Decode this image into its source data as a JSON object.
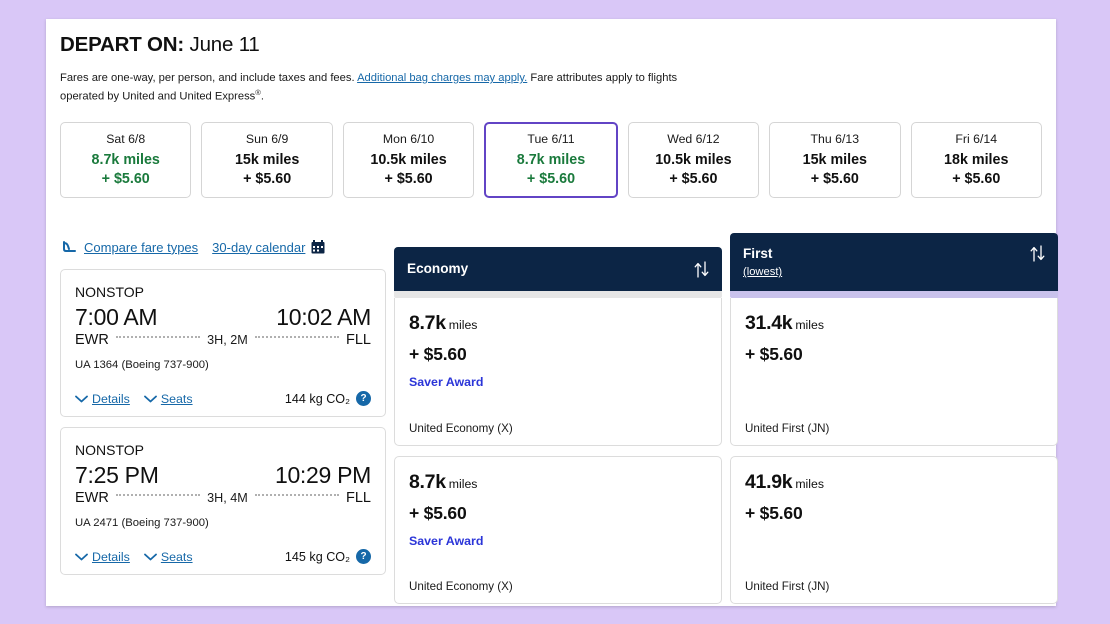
{
  "header": {
    "depart_label": "DEPART ON:",
    "depart_date": "June 11",
    "note_part1": "Fares are one-way, per person, and include taxes and fees.",
    "note_link": "Additional bag charges may apply.",
    "note_part2": "Fare attributes apply to flights operated by United and United Express",
    "note_sup": "®",
    "note_end": "."
  },
  "date_strip": [
    {
      "day": "Sat 6/8",
      "miles": "8.7k miles",
      "price": "+ $5.60",
      "cheapest": true,
      "selected": false
    },
    {
      "day": "Sun 6/9",
      "miles": "15k miles",
      "price": "+ $5.60",
      "cheapest": false,
      "selected": false
    },
    {
      "day": "Mon 6/10",
      "miles": "10.5k miles",
      "price": "+ $5.60",
      "cheapest": false,
      "selected": false
    },
    {
      "day": "Tue 6/11",
      "miles": "8.7k miles",
      "price": "+ $5.60",
      "cheapest": true,
      "selected": true
    },
    {
      "day": "Wed 6/12",
      "miles": "10.5k miles",
      "price": "+ $5.60",
      "cheapest": false,
      "selected": false
    },
    {
      "day": "Thu 6/13",
      "miles": "15k miles",
      "price": "+ $5.60",
      "cheapest": false,
      "selected": false
    },
    {
      "day": "Fri 6/14",
      "miles": "18k miles",
      "price": "+ $5.60",
      "cheapest": false,
      "selected": false
    }
  ],
  "toolbar": {
    "compare_label": "Compare fare types",
    "calendar_label": "30-day calendar",
    "seat_icon": "seat-icon",
    "calendar_icon": "calendar-icon"
  },
  "columns": {
    "economy": {
      "title": "Economy",
      "subtitle": "",
      "sort_icon": "sort-arrows-icon"
    },
    "first": {
      "title": "First",
      "subtitle": "(lowest)",
      "sort_icon": "sort-arrows-icon"
    }
  },
  "flights": [
    {
      "stops": "NONSTOP",
      "depart_time": "7:00 AM",
      "arrive_time": "10:02 AM",
      "origin": "EWR",
      "destination": "FLL",
      "duration": "3H, 2M",
      "flight_number": "UA 1364 (Boeing 737-900)",
      "details_label": "Details",
      "seats_label": "Seats",
      "co2": "144 kg CO₂",
      "help_glyph": "?",
      "economy": {
        "miles": "8.7k",
        "miles_unit": "miles",
        "cash": "+ $5.60",
        "award": "Saver Award",
        "class_name": "United Economy (X)"
      },
      "first": {
        "miles": "31.4k",
        "miles_unit": "miles",
        "cash": "+ $5.60",
        "award": "",
        "class_name": "United First (JN)"
      }
    },
    {
      "stops": "NONSTOP",
      "depart_time": "7:25 PM",
      "arrive_time": "10:29 PM",
      "origin": "EWR",
      "destination": "FLL",
      "duration": "3H, 4M",
      "flight_number": "UA 2471 (Boeing 737-900)",
      "details_label": "Details",
      "seats_label": "Seats",
      "co2": "145 kg CO₂",
      "help_glyph": "?",
      "economy": {
        "miles": "8.7k",
        "miles_unit": "miles",
        "cash": "+ $5.60",
        "award": "Saver Award",
        "class_name": "United Economy (X)"
      },
      "first": {
        "miles": "41.9k",
        "miles_unit": "miles",
        "cash": "+ $5.60",
        "award": "",
        "class_name": "United First (JN)"
      }
    }
  ],
  "colors": {
    "page_background": "#d9c7f7",
    "header_navy": "#0c2545",
    "cheap_green": "#1a7a3c",
    "selected_purple": "#6244c5",
    "link_blue": "#1668a8",
    "award_blue": "#2b35d8",
    "accent_lavender": "#c9c2ec"
  }
}
